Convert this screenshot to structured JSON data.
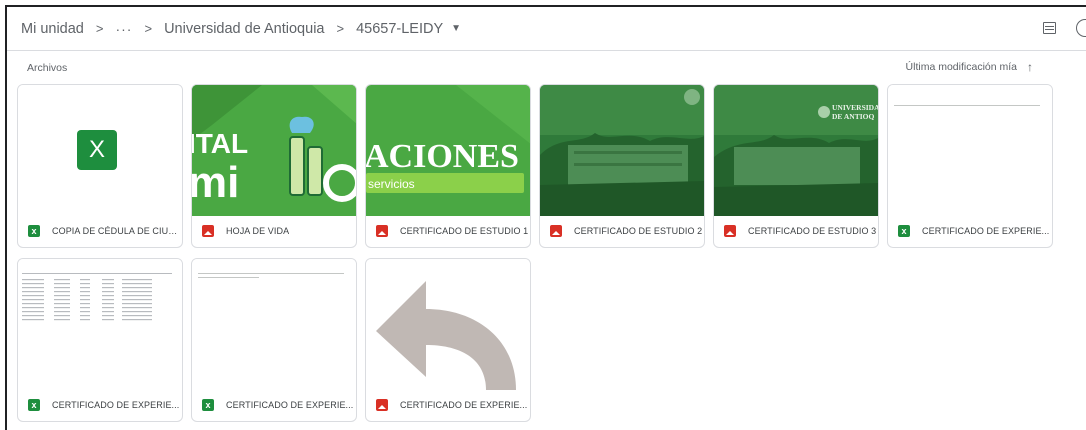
{
  "breadcrumb": {
    "root": "Mi unidad",
    "ellipsis": "···",
    "parent": "Universidad de Antioquia",
    "current": "45657-LEIDY"
  },
  "icons": {
    "view_toggle": "list-view-icon",
    "details": "info-icon"
  },
  "section": {
    "title": "Archivos"
  },
  "sort": {
    "label": "Última modificación mía",
    "direction_icon": "arrow-up-icon"
  },
  "colors": {
    "sheets_green": "#1e8e3e",
    "image_red": "#d93025",
    "banner_green": "#4aa843"
  },
  "thumbnail_text": {
    "capital": "ITAL",
    "familia": "mi",
    "aciones": "ACIONES",
    "servicios": "servicios",
    "universidad": "UNIVERSIDA",
    "antioquia": "DE ANTIOQ",
    "excel_letter": "X"
  },
  "files": [
    {
      "name": "COPIA DE CÉDULA DE CIUD...",
      "type": "spreadsheet"
    },
    {
      "name": "HOJA DE VIDA",
      "type": "image"
    },
    {
      "name": "CERTIFICADO DE ESTUDIO 1",
      "type": "image"
    },
    {
      "name": "CERTIFICADO DE ESTUDIO 2",
      "type": "image"
    },
    {
      "name": "CERTIFICADO DE ESTUDIO 3",
      "type": "image"
    },
    {
      "name": "CERTIFICADO DE EXPERIE...",
      "type": "spreadsheet"
    },
    {
      "name": "CERTIFICADO DE EXPERIE...",
      "type": "spreadsheet"
    },
    {
      "name": "CERTIFICADO DE EXPERIE...",
      "type": "spreadsheet"
    },
    {
      "name": "CERTIFICADO DE EXPERIE...",
      "type": "image"
    }
  ]
}
